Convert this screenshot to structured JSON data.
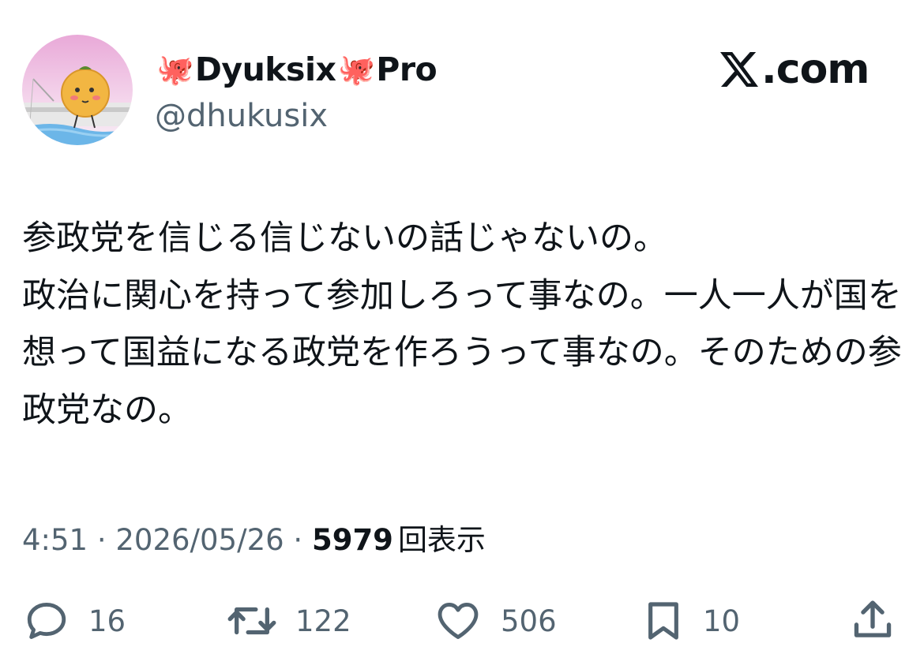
{
  "author": {
    "name_main": "Dyuksix",
    "name_suffix": "Pro",
    "name_emoji": "🐙",
    "handle": "@dhukusix"
  },
  "site_label": ".com",
  "tweet": {
    "text": "参政党を信じる信じないの話じゃないの。\n政治に関心を持って参加しろって事なの。一人一人が国を想って国益になる政党を作ろうって事なの。そのための参政党なの。"
  },
  "meta": {
    "time": "4:51",
    "separator": " · ",
    "date": "2026/05/26",
    "views_count": "5979",
    "views_label": "回表示"
  },
  "actions": {
    "replies": "16",
    "reposts": "122",
    "likes": "506",
    "bookmarks": "10"
  },
  "icons": {
    "reply": "reply-icon",
    "repost": "repost-icon",
    "like": "heart-icon",
    "bookmark": "bookmark-icon",
    "share": "share-icon",
    "x_logo": "x-logo-icon"
  },
  "colors": {
    "text": "#0f1419",
    "secondary": "#536471"
  }
}
